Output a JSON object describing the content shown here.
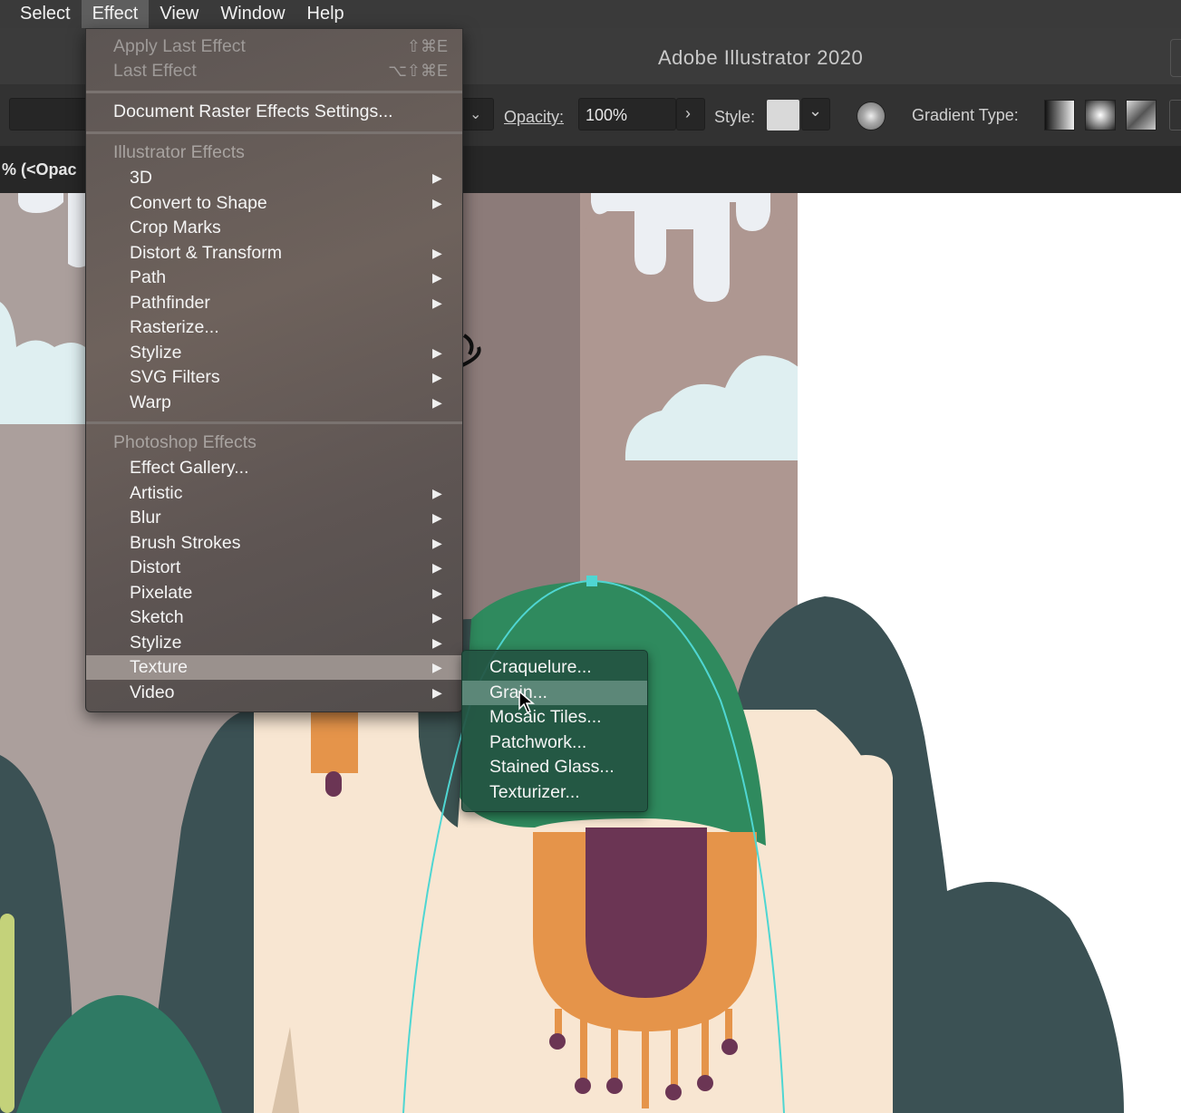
{
  "menubar": {
    "items": [
      "Select",
      "Effect",
      "View",
      "Window",
      "Help"
    ],
    "active": "Effect"
  },
  "window": {
    "title": "Adobe Illustrator 2020"
  },
  "control_bar": {
    "opacity_label": "Opacity:",
    "opacity_value": "100%",
    "style_label": "Style:",
    "gradient_type_label": "Gradient Type:"
  },
  "doc_tab": {
    "label": "% (<Opac"
  },
  "effect_menu": {
    "apply_last": {
      "label": "Apply Last Effect",
      "shortcut": "⇧⌘E"
    },
    "last_effect": {
      "label": "Last Effect",
      "shortcut": "⌥⇧⌘E"
    },
    "doc_raster": "Document Raster Effects Settings...",
    "illustrator_header": "Illustrator Effects",
    "illustrator_items": [
      {
        "label": "3D",
        "sub": true
      },
      {
        "label": "Convert to Shape",
        "sub": true
      },
      {
        "label": "Crop Marks",
        "sub": false
      },
      {
        "label": "Distort & Transform",
        "sub": true
      },
      {
        "label": "Path",
        "sub": true
      },
      {
        "label": "Pathfinder",
        "sub": true
      },
      {
        "label": "Rasterize...",
        "sub": false
      },
      {
        "label": "Stylize",
        "sub": true
      },
      {
        "label": "SVG Filters",
        "sub": true
      },
      {
        "label": "Warp",
        "sub": true
      }
    ],
    "photoshop_header": "Photoshop Effects",
    "photoshop_items": [
      {
        "label": "Effect Gallery...",
        "sub": false
      },
      {
        "label": "Artistic",
        "sub": true
      },
      {
        "label": "Blur",
        "sub": true
      },
      {
        "label": "Brush Strokes",
        "sub": true
      },
      {
        "label": "Distort",
        "sub": true
      },
      {
        "label": "Pixelate",
        "sub": true
      },
      {
        "label": "Sketch",
        "sub": true
      },
      {
        "label": "Stylize",
        "sub": true
      },
      {
        "label": "Texture",
        "sub": true
      },
      {
        "label": "Video",
        "sub": true
      }
    ],
    "highlighted": "Texture"
  },
  "texture_submenu": {
    "items": [
      "Craquelure...",
      "Grain...",
      "Mosaic Tiles...",
      "Patchwork...",
      "Stained Glass...",
      "Texturizer..."
    ],
    "highlighted": "Grain..."
  },
  "colors": {
    "menu_highlight": "#9a918d",
    "submenu_bg": "#245442",
    "selection_outline": "#4fd6d2"
  }
}
